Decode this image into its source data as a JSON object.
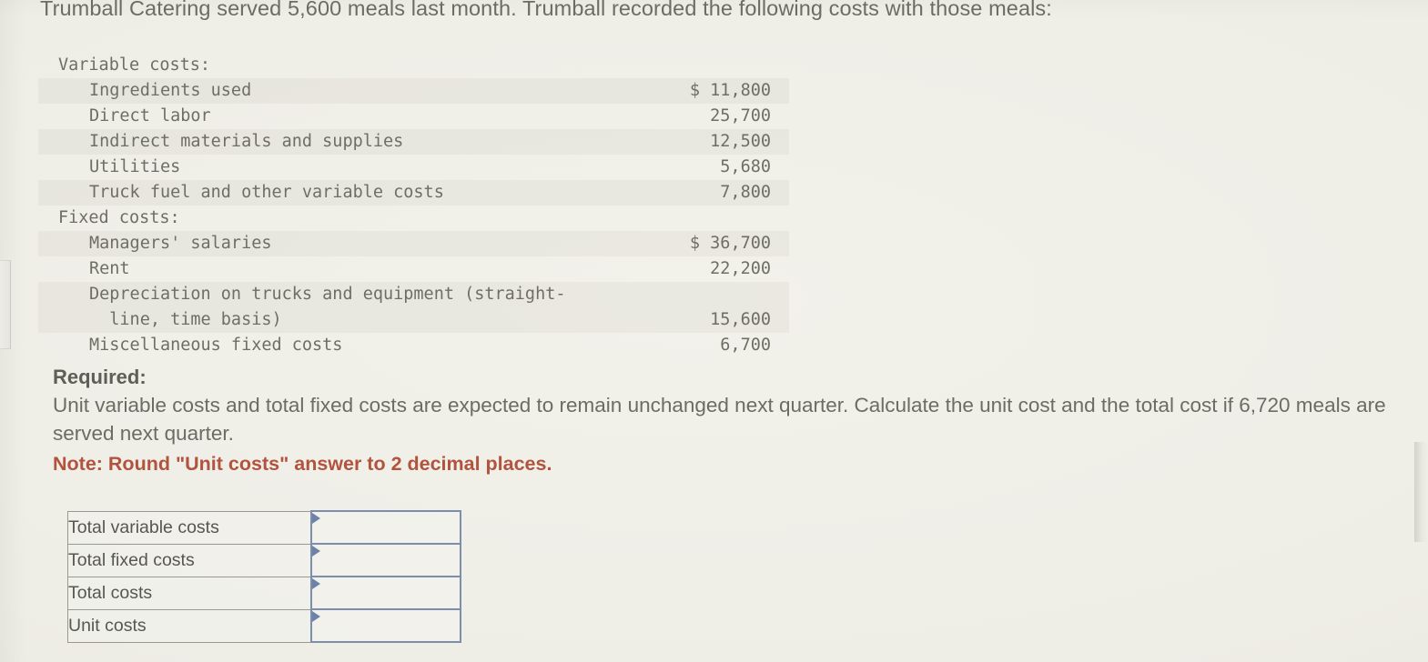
{
  "intro": {
    "text": "Trumball Catering served 5,600 meals last month. Trumball recorded the following costs with those meals:"
  },
  "schedule": {
    "sections": [
      {
        "heading": "Variable costs:",
        "rows": [
          {
            "label": "Ingredients used",
            "amount": "$ 11,800"
          },
          {
            "label": "Direct labor",
            "amount": "25,700"
          },
          {
            "label": "Indirect materials and supplies",
            "amount": "12,500"
          },
          {
            "label": "Utilities",
            "amount": "5,680"
          },
          {
            "label": "Truck fuel and other variable costs",
            "amount": "7,800"
          }
        ]
      },
      {
        "heading": "Fixed costs:",
        "rows": [
          {
            "label": "Managers' salaries",
            "amount": "$ 36,700"
          },
          {
            "label": "Rent",
            "amount": "22,200"
          },
          {
            "label": "Depreciation on trucks and equipment (straight-\n  line, time basis)",
            "amount": "15,600"
          },
          {
            "label": "Miscellaneous fixed costs",
            "amount": "6,700"
          }
        ]
      }
    ]
  },
  "required": {
    "title": "Required:",
    "body": "Unit variable costs and total fixed costs are expected to remain unchanged next quarter. Calculate the unit cost and the total cost if 6,720 meals are served next quarter.",
    "note": "Note: Round \"Unit costs\" answer to 2 decimal places."
  },
  "answer_table": {
    "rows": [
      {
        "label": "Total variable costs",
        "value": ""
      },
      {
        "label": "Total fixed costs",
        "value": ""
      },
      {
        "label": "Total costs",
        "value": ""
      },
      {
        "label": "Unit costs",
        "value": ""
      }
    ]
  },
  "colors": {
    "page_background": "#efefe8",
    "body_text": "#6d6c63",
    "note_text": "#b2533e",
    "input_border": "#7d8ead",
    "input_marker": "#6e82a8",
    "table_border": "#9a9890",
    "stripe": "rgba(130,128,118,0.075)"
  }
}
